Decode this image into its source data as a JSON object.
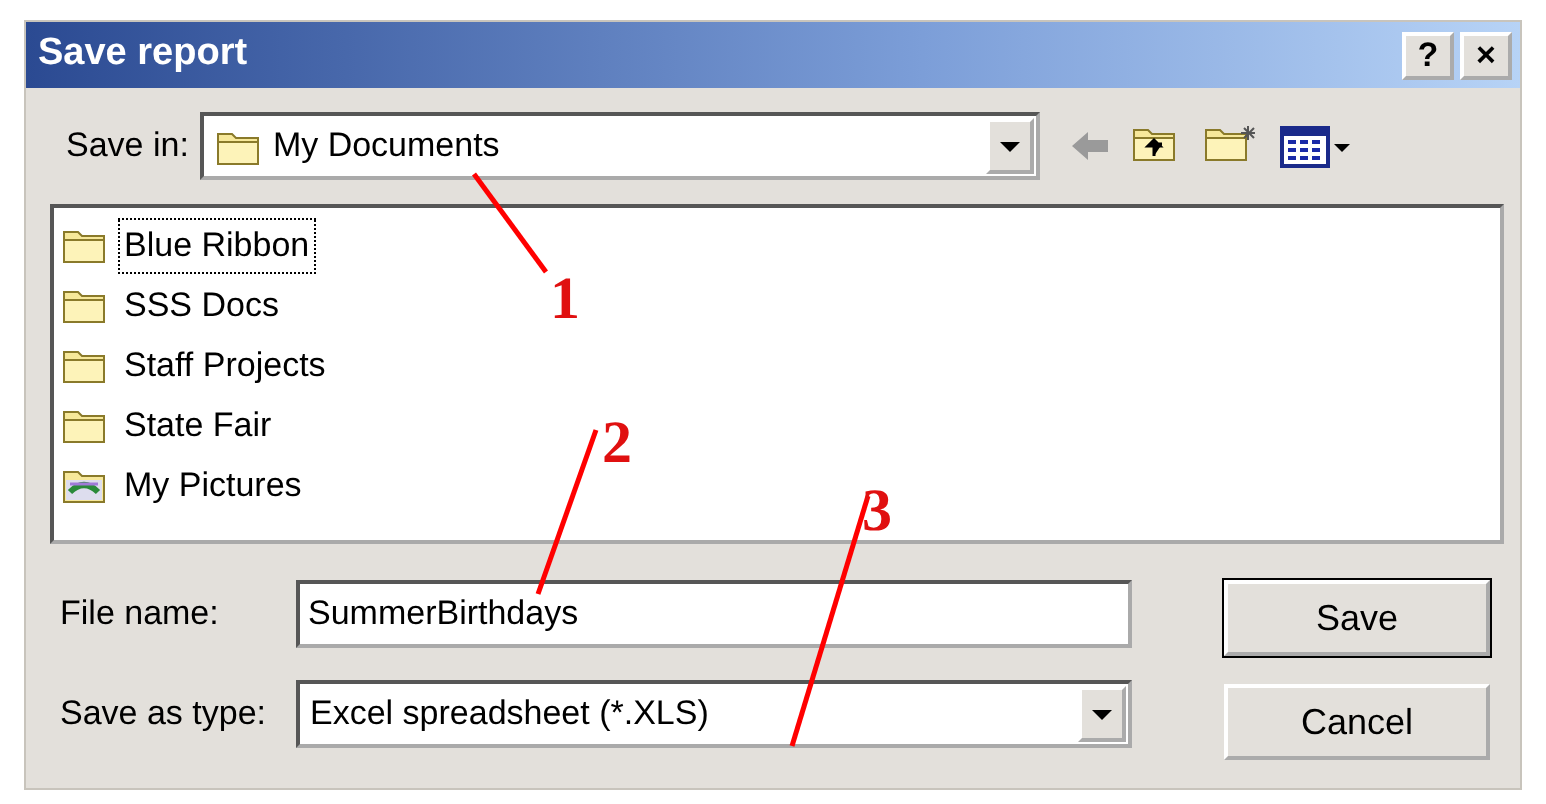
{
  "window": {
    "title": "Save report",
    "title_buttons": [
      "?",
      "×"
    ]
  },
  "save_in": {
    "label": "Save in:",
    "value": "My Documents"
  },
  "files": [
    {
      "name": "Blue Ribbon",
      "kind": "folder",
      "selected": true
    },
    {
      "name": "SSS Docs",
      "kind": "folder",
      "selected": false
    },
    {
      "name": "Staff Projects",
      "kind": "folder",
      "selected": false
    },
    {
      "name": "State Fair",
      "kind": "folder",
      "selected": false
    },
    {
      "name": "My Pictures",
      "kind": "pictures",
      "selected": false
    }
  ],
  "file_name": {
    "label": "File name:",
    "value": "SummerBirthdays"
  },
  "save_as_type": {
    "label": "Save as type:",
    "value": "Excel spreadsheet (*.XLS)"
  },
  "buttons": [
    "Save",
    "Cancel"
  ],
  "callouts": [
    {
      "label": "1"
    },
    {
      "label": "2"
    },
    {
      "label": "3"
    }
  ]
}
